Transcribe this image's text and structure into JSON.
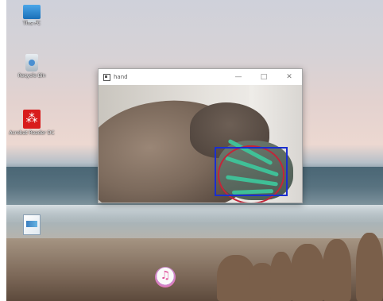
{
  "desktop": {
    "icons": [
      {
        "label": "This PC",
        "icon": "computer-icon"
      },
      {
        "label": "Recycle Bin",
        "icon": "recycle-bin-icon"
      },
      {
        "label": "Acrobat Reader DC",
        "icon": "pdf-icon"
      },
      {
        "label": "",
        "icon": "document-icon"
      },
      {
        "label": "",
        "icon": "itunes-icon"
      }
    ]
  },
  "window": {
    "title": "hand",
    "controls": {
      "minimize": "—",
      "maximize": "□",
      "close": "✕"
    },
    "overlay_colors": {
      "circle": "#c2263a",
      "box": "#1a2fd0",
      "mask": "#3ec49a"
    }
  }
}
